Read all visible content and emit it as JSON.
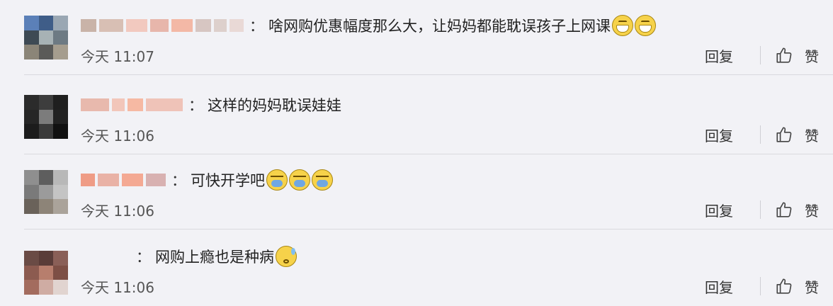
{
  "comments": [
    {
      "text": "啥网购优惠幅度那么大，让妈妈都能耽误孩子上网课",
      "emojis": [
        "grin",
        "grin"
      ],
      "time": "今天 11:07",
      "avatar_colors": [
        "#5b80b8",
        "#3f5d88",
        "#9aa7b3",
        "#3e4a54",
        "#a7b2b5",
        "#6d7a83",
        "#8b8578",
        "#5a5a58",
        "#a59d8e"
      ],
      "name_blocks": [
        "#c9b3a8",
        "#d8bfb4",
        "#f2c9bf",
        "#e7b6ab",
        "#f3b8a6",
        "#d7c6c2",
        "#ddd0cc",
        "#e9d9d6"
      ]
    },
    {
      "text": "这样的妈妈耽误娃娃",
      "emojis": [],
      "time": "今天 11:06",
      "avatar_colors": [
        "#2b2b2b",
        "#3d3d3d",
        "#1f1f1f",
        "#262626",
        "#7c7c7c",
        "#222222",
        "#1c1c1c",
        "#3a3a3a",
        "#111111"
      ],
      "name_blocks": [
        "#e8b9ad",
        "#f2c6ba",
        "#f6b9a3",
        "#efc3b8"
      ]
    },
    {
      "text": "可快开学吧",
      "emojis": [
        "cry",
        "cry",
        "cry"
      ],
      "time": "今天 11:06",
      "avatar_colors": [
        "#8f8f8f",
        "#5e5e5e",
        "#b8b8b8",
        "#7a7a7a",
        "#9b9b9b",
        "#c4c4c4",
        "#6a625a",
        "#8d8478",
        "#aaa39a"
      ],
      "name_blocks": [
        "#ef9c86",
        "#e9b2a6",
        "#f4a993",
        "#d8b1b1"
      ]
    },
    {
      "text": "网购上瘾也是种病",
      "emojis": [
        "sweat"
      ],
      "time": "今天 11:06",
      "avatar_colors": [
        "#6a4b45",
        "#5a3c38",
        "#8a5f57",
        "#8c5b50",
        "#b77e6d",
        "#7d4f45",
        "#a36c5e",
        "#cfaca3",
        "#e1d4d0"
      ],
      "name_blocks": []
    }
  ],
  "actions": {
    "reply_label": "回复",
    "like_label": "赞"
  },
  "separator": "："
}
